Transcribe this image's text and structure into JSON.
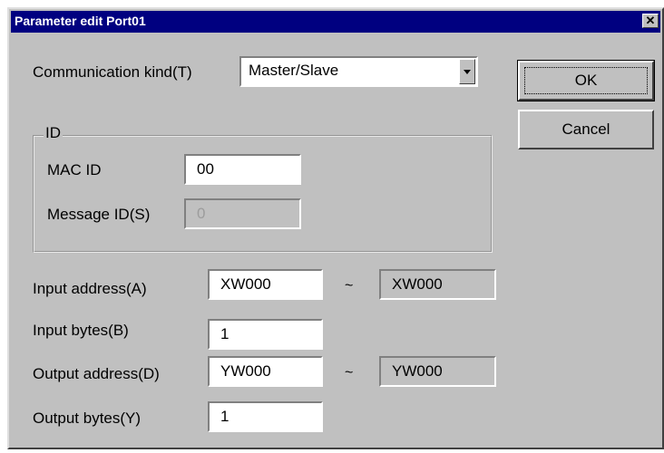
{
  "dialog": {
    "title": "Parameter edit Port01",
    "close_glyph": "✕"
  },
  "communication_kind": {
    "label": "Communication kind(T)",
    "value": "Master/Slave"
  },
  "id_group": {
    "legend": "ID",
    "mac_id": {
      "label": "MAC ID",
      "value": "00"
    },
    "message_id": {
      "label": "Message ID(S)",
      "value": "0"
    }
  },
  "io": {
    "input_address": {
      "label": "Input address(A)",
      "from": "XW000",
      "to": "XW000"
    },
    "input_bytes": {
      "label": "Input bytes(B)",
      "value": "1"
    },
    "output_address": {
      "label": "Output address(D)",
      "from": "YW000",
      "to": "YW000"
    },
    "output_bytes": {
      "label": "Output bytes(Y)",
      "value": "1"
    },
    "range_separator": "~"
  },
  "buttons": {
    "ok": "OK",
    "cancel": "Cancel"
  },
  "icons": {
    "close": "close-icon",
    "dropdown": "chevron-down-icon"
  },
  "colors": {
    "title_bar": "#000080",
    "face": "#c0c0c0"
  }
}
